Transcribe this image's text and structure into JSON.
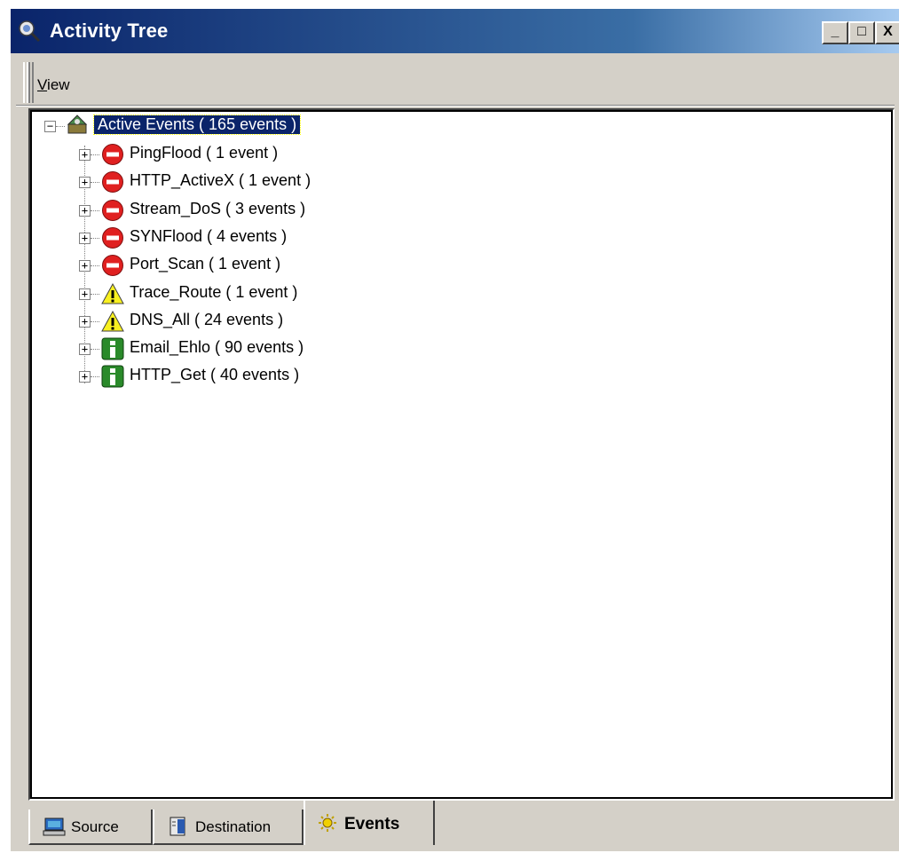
{
  "window": {
    "title": "Activity Tree",
    "controls": {
      "minimize": "_",
      "maximize": "□",
      "close": "X"
    }
  },
  "menu": {
    "view_label": "View",
    "view_mnemonic": "V",
    "view_rest": "iew"
  },
  "tree": {
    "root": {
      "label": "Active Events  ( 165 events )",
      "expander": "−",
      "icon": "network-icon"
    },
    "items": [
      {
        "label": "PingFlood  ( 1 event )",
        "icon": "stop-icon"
      },
      {
        "label": "HTTP_ActiveX  ( 1 event )",
        "icon": "stop-icon"
      },
      {
        "label": "Stream_DoS  ( 3 events )",
        "icon": "stop-icon"
      },
      {
        "label": "SYNFlood  ( 4 events )",
        "icon": "stop-icon"
      },
      {
        "label": "Port_Scan  ( 1 event )",
        "icon": "stop-icon"
      },
      {
        "label": "Trace_Route  ( 1 event )",
        "icon": "warning-icon"
      },
      {
        "label": "DNS_All  ( 24 events )",
        "icon": "warning-icon"
      },
      {
        "label": "Email_Ehlo  ( 90 events )",
        "icon": "info-icon"
      },
      {
        "label": "HTTP_Get  ( 40 events )",
        "icon": "info-icon"
      }
    ],
    "expander_plus": "+"
  },
  "tabs": [
    {
      "label": "Source",
      "icon": "computer-icon",
      "active": false
    },
    {
      "label": "Destination",
      "icon": "server-icon",
      "active": false
    },
    {
      "label": "Events",
      "icon": "events-icon",
      "active": true
    }
  ],
  "colors": {
    "titlebar_start": "#0a246a",
    "titlebar_end": "#a6caf0",
    "face": "#d4d0c8",
    "selection": "#0a246a",
    "stop": "#e02020",
    "warning": "#f8f020",
    "info": "#2a8a2a"
  }
}
